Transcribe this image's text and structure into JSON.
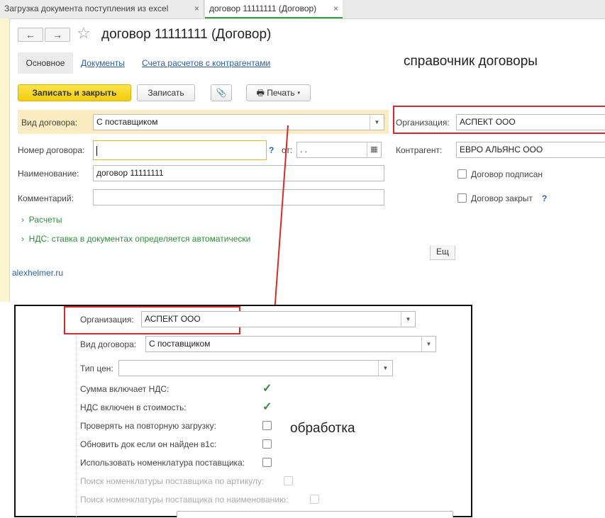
{
  "tabs": [
    {
      "label": "Загрузка документа поступления из excel",
      "close": "×"
    },
    {
      "label": "договор 11111111 (Договор)",
      "close": "×"
    }
  ],
  "header": {
    "back_icon": "←",
    "forward_icon": "→",
    "star_icon": "☆",
    "title": "договор 11111111 (Договор)"
  },
  "sections": {
    "main": "Основное",
    "documents": "Документы",
    "accounts": "Счета расчетов с контрагентами"
  },
  "annotation_top": "справочник договоры",
  "annotation_bottom": "обработка",
  "toolbar": {
    "save_close": "Записать и закрыть",
    "save": "Записать",
    "clip_icon": "📎",
    "print": "Печать",
    "print_icon": "🖶",
    "print_arrow": "▾"
  },
  "form": {
    "contract_type_label": "Вид договора:",
    "contract_type_value": "С поставщиком",
    "number_label": "Номер договора:",
    "number_value": "",
    "from_label": "от:",
    "date_value": " .  .",
    "name_label": "Наименование:",
    "name_value": "договор 11111111",
    "comment_label": "Комментарий:",
    "comment_value": "",
    "org_label": "Организация:",
    "org_value": "АСПЕКТ ООО",
    "counterparty_label": "Контрагент:",
    "counterparty_value": "ЕВРО АЛЬЯНС ООО",
    "signed_label": "Договор подписан",
    "closed_label": "Договор закрыт",
    "help": "?",
    "settlements": "Расчеты",
    "vat": "НДС: ставка в документах определяется автоматически",
    "cut_button": "Ещ",
    "site_link": "alexhelmer.ru"
  },
  "processing": {
    "org_label": "Организация:",
    "org_value": "АСПЕКТ ООО",
    "contract_type_label": "Вид договора:",
    "contract_type_value": "С поставщиком",
    "price_type_label": "Тип цен:",
    "price_type_value": "",
    "flags": [
      {
        "label": "Сумма включает НДС:",
        "checked": true,
        "disabled": false
      },
      {
        "label": "НДС включен в стоимость:",
        "checked": true,
        "disabled": false
      },
      {
        "label": "Проверять на повторную загрузку:",
        "checked": false,
        "disabled": false
      },
      {
        "label": "Обновить док если он найден в1с:",
        "checked": false,
        "disabled": false
      },
      {
        "label": "Использовать номенклатура поставщика:",
        "checked": false,
        "disabled": false
      },
      {
        "label": "Поиск номенклатуры поставщика по артикулу:",
        "checked": false,
        "disabled": true
      },
      {
        "label": "Поиск номенклатуры поставщика по наименованию:",
        "checked": false,
        "disabled": true
      }
    ]
  },
  "colors": {
    "accent_red": "#d72b2b",
    "green": "#2f8f3d",
    "yellow": "#f2cb0c"
  }
}
